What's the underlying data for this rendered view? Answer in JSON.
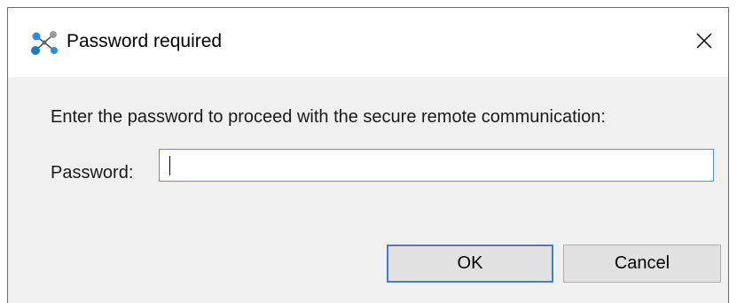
{
  "window": {
    "title": "Password required",
    "app_icon": "network-nodes-icon",
    "close_icon": "close-icon"
  },
  "dialog": {
    "prompt": "Enter the password to proceed with the secure remote communication:",
    "password_label": "Password:",
    "password_value": "",
    "password_placeholder": ""
  },
  "buttons": {
    "ok_label": "OK",
    "cancel_label": "Cancel"
  },
  "colors": {
    "focus_accent": "#3c7fd1",
    "input_border": "#5a8fd6",
    "dialog_background": "#f0f0f0"
  }
}
